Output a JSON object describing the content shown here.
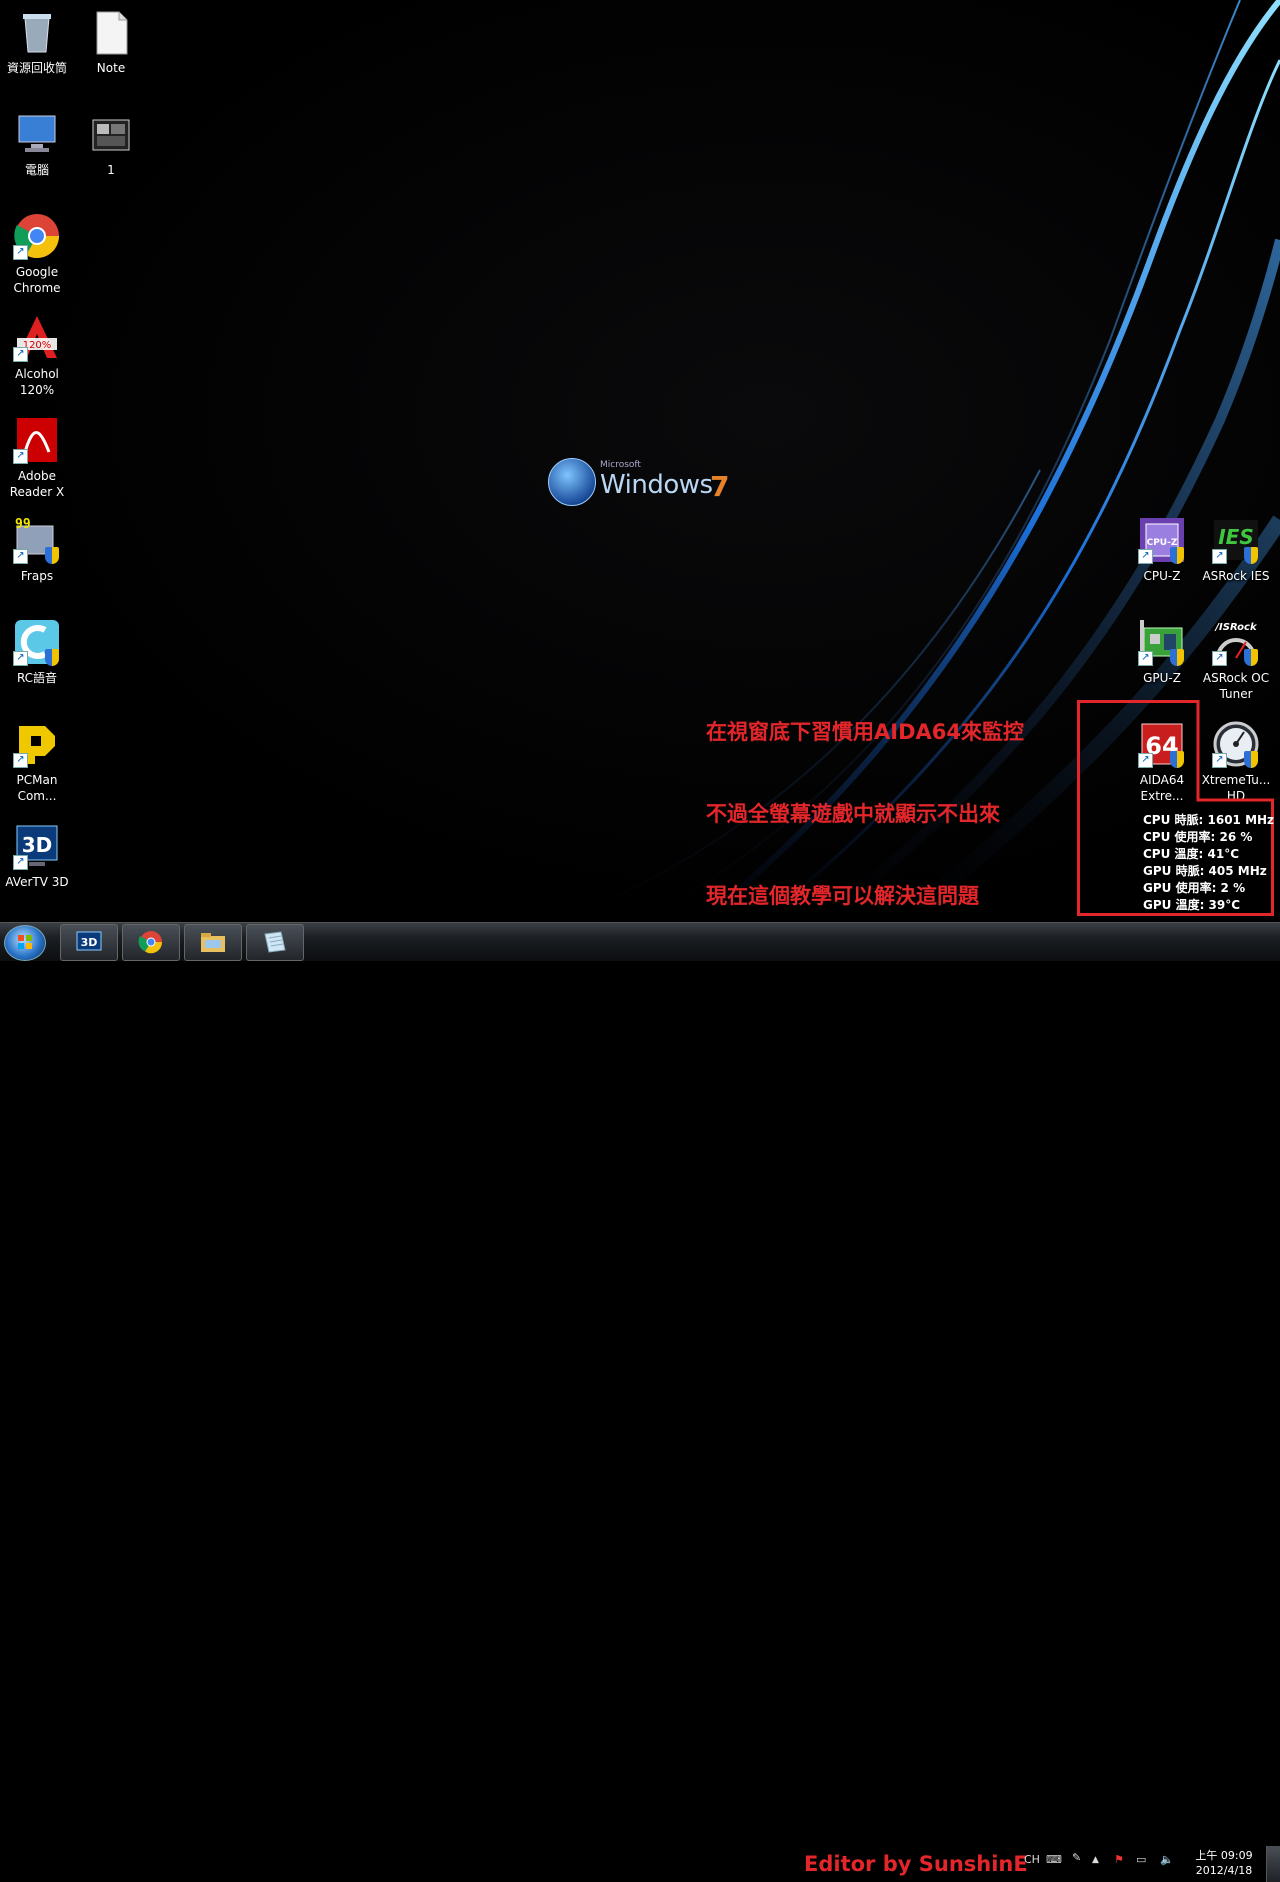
{
  "desktop": {
    "left_icons": [
      {
        "name": "recycle-bin-icon",
        "label": "資源回收筒"
      },
      {
        "name": "note-file-icon",
        "label": "Note"
      },
      {
        "name": "computer-icon",
        "label": "電腦"
      },
      {
        "name": "folder-1-icon",
        "label": "1"
      },
      {
        "name": "google-chrome-icon",
        "label": "Google\nChrome"
      },
      {
        "name": "alcohol-120-icon",
        "label": "Alcohol\n120%"
      },
      {
        "name": "adobe-reader-icon",
        "label": "Adobe\nReader X"
      },
      {
        "name": "fraps-icon",
        "label": "Fraps"
      },
      {
        "name": "rc-voice-icon",
        "label": "RC語音"
      },
      {
        "name": "pcman-icon",
        "label": "PCMan\nCom..."
      },
      {
        "name": "avertv-3d-icon",
        "label": "AVerTV 3D"
      }
    ],
    "right_icons": [
      {
        "name": "cpu-z-icon",
        "label": "CPU-Z"
      },
      {
        "name": "asrock-ies-icon",
        "label": "ASRock IES"
      },
      {
        "name": "gpu-z-icon",
        "label": "GPU-Z"
      },
      {
        "name": "asrock-oc-tuner-icon",
        "label": "ASRock OC\nTuner"
      },
      {
        "name": "aida64-icon",
        "label": "AIDA64\nExtre..."
      },
      {
        "name": "xtremetuner-icon",
        "label": "XtremeTu...\nHD"
      }
    ],
    "icon_glyphs": {
      "fraps": "99",
      "aida": "64",
      "alcohol": "120%",
      "cpuz": "CPU-Z",
      "ies": "IES",
      "asrock": "/ISRock",
      "avertv": "3D"
    },
    "wallpaper_logo": {
      "microsoft": "Microsoft",
      "windows": "Windows",
      "seven": "7"
    },
    "notes": [
      "在視窗底下習慣用AIDA64來監控",
      "不過全螢幕遊戲中就顯示不出來",
      "現在這個教學可以解決這問題"
    ],
    "osd_lines": [
      "CPU 時脈: 1601 MHz",
      "CPU 使用率: 26 %",
      "CPU 溫度: 41°C",
      "GPU 時脈: 405 MHz",
      "GPU 使用率: 2 %",
      "GPU 溫度: 39°C"
    ]
  },
  "taskbar": {
    "pinned": [
      {
        "name": "taskbar-avertv-button",
        "icon": "avertv-3d-icon"
      },
      {
        "name": "taskbar-chrome-button",
        "icon": "chrome-icon"
      },
      {
        "name": "taskbar-explorer-button",
        "icon": "explorer-icon"
      },
      {
        "name": "taskbar-note-button",
        "icon": "note-icon"
      }
    ],
    "editor_credit": "Editor by SunshinE",
    "tray": {
      "input_lang": "CH",
      "show_hidden": "▲"
    },
    "clock": {
      "time": "上午 09:09",
      "date": "2012/4/18"
    }
  },
  "colors": {
    "annotation_red": "#e3262a",
    "taskbar": "#1b1e22"
  }
}
